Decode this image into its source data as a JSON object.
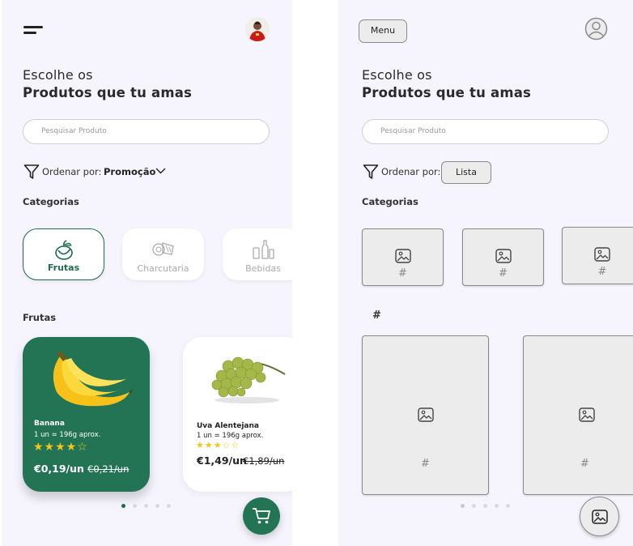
{
  "design": {
    "title_line1": "Escolhe os",
    "title_line2": "Produtos que tu amas",
    "search_placeholder": "Pesquisar Produto",
    "sort_label": "Ordenar por:",
    "sort_value": "Promoção",
    "categories_title": "Categorias",
    "categories": [
      {
        "label": "Frutas",
        "icon": "fruit-icon",
        "active": true
      },
      {
        "label": "Charcutaria",
        "icon": "charcuterie-icon",
        "active": false
      },
      {
        "label": "Bebidas",
        "icon": "drinks-icon",
        "active": false
      }
    ],
    "section_title": "Frutas",
    "products": [
      {
        "name": "Banana",
        "weight": "1 un = 196g aprox.",
        "rating": 4,
        "stars": "★★★★☆",
        "price": "€0,19/un",
        "old_price": "€0,21/un",
        "image": "banana-image"
      },
      {
        "name": "Uva Alentejana",
        "weight": "1 un = 196g aprox.",
        "rating": 2.5,
        "stars": "★★★☆☆",
        "price": "€1,49/un",
        "old_price": "€1,89/un",
        "image": "grapes-image"
      }
    ],
    "carousel_pages": 5,
    "carousel_active": 0,
    "colors": {
      "accent": "#237455",
      "star": "#f5c518",
      "background": "#f6f5fd"
    }
  },
  "wireframe": {
    "menu_label": "Menu",
    "title_line1": "Escolhe os",
    "title_line2": "Produtos que tu amas",
    "search_placeholder": "Pesquisar Produto",
    "sort_label": "Ordenar por:",
    "sort_value": "Lista",
    "categories_title": "Categorias",
    "placeholder_hash": "#",
    "section_title": "#",
    "carousel_pages": 5
  }
}
